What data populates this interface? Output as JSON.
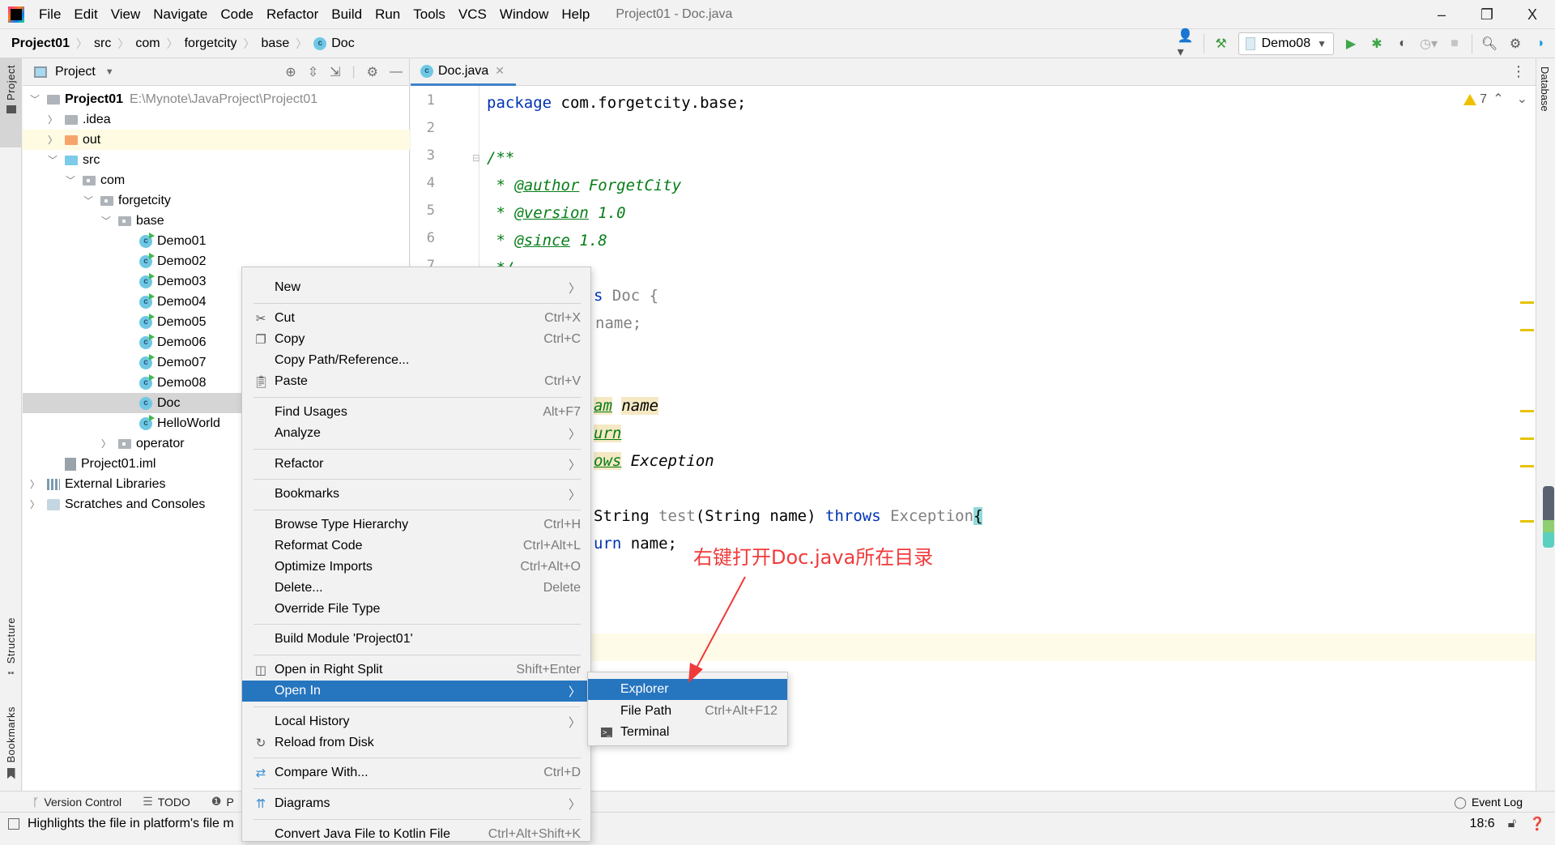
{
  "window": {
    "title": "Project01 - Doc.java",
    "controls": {
      "minimize": "–",
      "restore": "❐",
      "close": "X"
    }
  },
  "menubar": [
    {
      "label": "File"
    },
    {
      "label": "Edit"
    },
    {
      "label": "View"
    },
    {
      "label": "Navigate"
    },
    {
      "label": "Code"
    },
    {
      "label": "Refactor"
    },
    {
      "label": "Build"
    },
    {
      "label": "Run"
    },
    {
      "label": "Tools"
    },
    {
      "label": "VCS"
    },
    {
      "label": "Window"
    },
    {
      "label": "Help"
    }
  ],
  "breadcrumb": [
    "Project01",
    "src",
    "com",
    "forgetcity",
    "base",
    "Doc"
  ],
  "toolbar": {
    "run_config": "Demo08"
  },
  "left_strip": {
    "project": "Project",
    "structure": "Structure",
    "bookmarks": "Bookmarks"
  },
  "right_strip": {
    "database": "Database"
  },
  "project_panel": {
    "title": "Project",
    "tree": [
      {
        "label": "Project01",
        "extra": "E:\\Mynote\\JavaProject\\Project01",
        "bold": true
      },
      {
        "label": ".idea"
      },
      {
        "label": "out"
      },
      {
        "label": "src"
      },
      {
        "label": "com"
      },
      {
        "label": "forgetcity"
      },
      {
        "label": "base"
      },
      {
        "label": "Demo01"
      },
      {
        "label": "Demo02"
      },
      {
        "label": "Demo03"
      },
      {
        "label": "Demo04"
      },
      {
        "label": "Demo05"
      },
      {
        "label": "Demo06"
      },
      {
        "label": "Demo07"
      },
      {
        "label": "Demo08"
      },
      {
        "label": "Doc"
      },
      {
        "label": "HelloWorld"
      },
      {
        "label": "operator"
      },
      {
        "label": "Project01.iml"
      },
      {
        "label": "External Libraries"
      },
      {
        "label": "Scratches and Consoles"
      }
    ]
  },
  "editor": {
    "tab": "Doc.java",
    "warnings": "7",
    "line_numbers": [
      "1",
      "2",
      "3",
      "4",
      "5",
      "6",
      "7"
    ],
    "code": {
      "l1_kw": "package",
      "l1_rest": " com.forgetcity.base;",
      "l3": "/**",
      "l4_star": " * ",
      "l4_tag": "@author",
      "l4_val": " ForgetCity",
      "l5_star": " * ",
      "l5_tag": "@version",
      "l5_val": " 1.0",
      "l6_star": " * ",
      "l6_tag": "@since",
      "l6_val": " 1.8",
      "l7": " */",
      "l8_kw": "s",
      "l8_rest": " Doc {",
      "l9": "name;",
      "l12_tag": "am",
      "l12_val": "name",
      "l13_tag": "urn",
      "l14_tag": "ows",
      "l14_val": " Exception",
      "l16_a": "String ",
      "l16_method": "test",
      "l16_b": "(String name) ",
      "l16_kw": "throws",
      "l16_exc": " Exception",
      "l16_brace": "{",
      "l17_kw": "urn",
      "l17_rest": " name;"
    }
  },
  "context_menu": {
    "items": [
      {
        "label": "New",
        "submenu": true
      },
      {
        "label": "Cut",
        "shortcut": "Ctrl+X",
        "icon": "scissors"
      },
      {
        "label": "Copy",
        "shortcut": "Ctrl+C",
        "icon": "copy"
      },
      {
        "label": "Copy Path/Reference..."
      },
      {
        "label": "Paste",
        "shortcut": "Ctrl+V",
        "icon": "clipboard"
      },
      {
        "label": "Find Usages",
        "shortcut": "Alt+F7"
      },
      {
        "label": "Analyze",
        "submenu": true
      },
      {
        "label": "Refactor",
        "submenu": true
      },
      {
        "label": "Bookmarks",
        "submenu": true
      },
      {
        "label": "Browse Type Hierarchy",
        "shortcut": "Ctrl+H"
      },
      {
        "label": "Reformat Code",
        "shortcut": "Ctrl+Alt+L"
      },
      {
        "label": "Optimize Imports",
        "shortcut": "Ctrl+Alt+O"
      },
      {
        "label": "Delete...",
        "shortcut": "Delete"
      },
      {
        "label": "Override File Type"
      },
      {
        "label": "Build Module 'Project01'"
      },
      {
        "label": "Open in Right Split",
        "shortcut": "Shift+Enter",
        "icon": "split"
      },
      {
        "label": "Open In",
        "submenu": true,
        "active": true
      },
      {
        "label": "Local History",
        "submenu": true
      },
      {
        "label": "Reload from Disk",
        "icon": "reload"
      },
      {
        "label": "Compare With...",
        "shortcut": "Ctrl+D",
        "icon": "compare"
      },
      {
        "label": "Diagrams",
        "submenu": true,
        "icon": "diagram"
      },
      {
        "label": "Convert Java File to Kotlin File",
        "shortcut": "Ctrl+Alt+Shift+K"
      }
    ]
  },
  "submenu": {
    "items": [
      {
        "label": "Explorer",
        "active": true
      },
      {
        "label": "File Path",
        "shortcut": "Ctrl+Alt+F12"
      },
      {
        "label": "Terminal",
        "icon": "terminal"
      }
    ]
  },
  "annotation": "右键打开Doc.java所在目录",
  "tool_window_bar": {
    "version_control": "Version Control",
    "todo": "TODO",
    "problems_partial": "P",
    "event_log": "Event Log"
  },
  "status_bar": {
    "message": "Highlights the file in platform's file m",
    "position": "18:6"
  },
  "colors": {
    "accent": "#2675bf",
    "annotation": "#f03a3a",
    "warning": "#f0c000"
  }
}
